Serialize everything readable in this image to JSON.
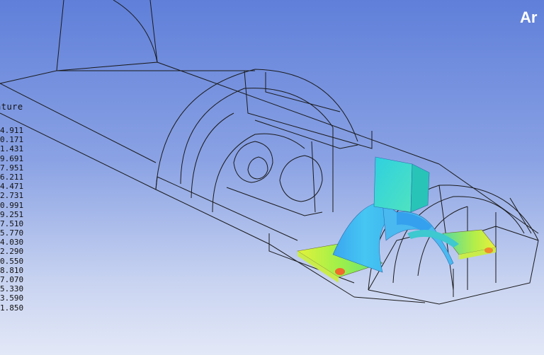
{
  "brand": {
    "logo_text": "Ar"
  },
  "legend": {
    "title": "ature",
    "values": [
      "4.911",
      "0.171",
      "1.431",
      "9.691",
      "7.951",
      "6.211",
      "4.471",
      "2.731",
      "0.991",
      "9.251",
      "7.510",
      "5.770",
      "4.030",
      "2.290",
      "0.550",
      "8.810",
      "7.070",
      "5.330",
      "3.590",
      "1.850"
    ]
  },
  "colors": {
    "background_top": "#5f7fd9",
    "background_bottom": "#e3e8f7",
    "wireframe": "#1a1a1a",
    "contour_cool": "#3fb8f0",
    "contour_mid": "#29d6c9",
    "contour_warm": "#c8f04a",
    "contour_hot": "#f08a2a"
  }
}
